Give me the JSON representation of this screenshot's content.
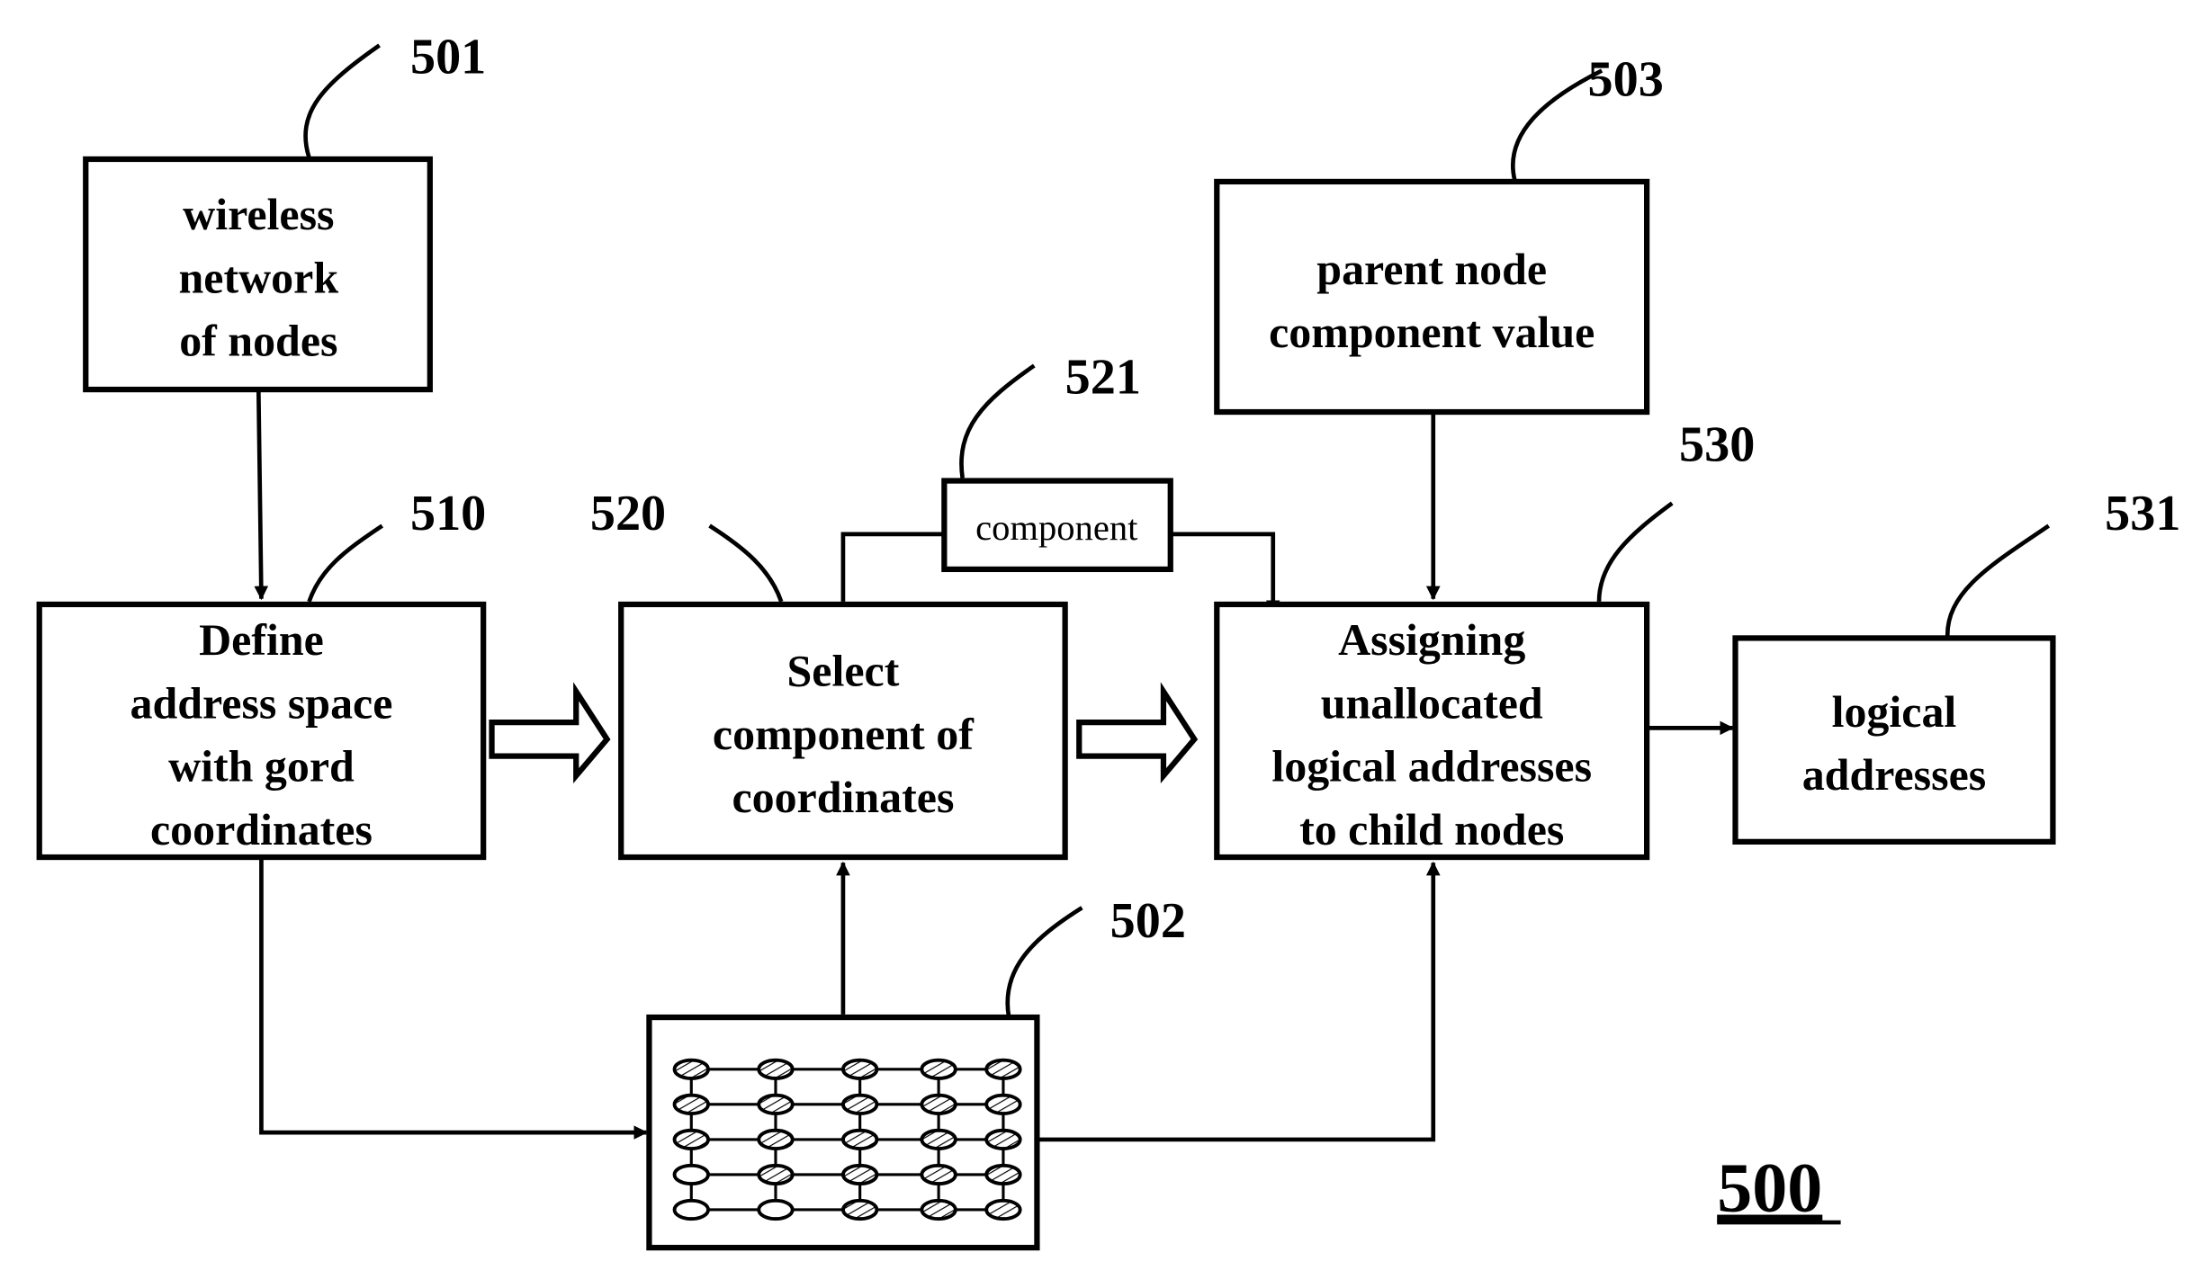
{
  "figure_label": "500",
  "boxes": {
    "b501": {
      "ref": "501",
      "lines": [
        "wireless",
        "network",
        "of nodes"
      ]
    },
    "b510": {
      "ref": "510",
      "lines": [
        "Define",
        "address space",
        "with gord",
        "coordinates"
      ]
    },
    "b520": {
      "ref": "520",
      "lines": [
        "Select",
        "component of",
        "coordinates"
      ]
    },
    "b521": {
      "ref": "521",
      "lines": [
        "component"
      ]
    },
    "b503": {
      "ref": "503",
      "lines": [
        "parent node",
        "component value"
      ]
    },
    "b530": {
      "ref": "530",
      "lines": [
        "Assigning",
        "unallocated",
        "logical addresses",
        "to child nodes"
      ]
    },
    "b531": {
      "ref": "531",
      "lines": [
        "logical",
        "addresses"
      ]
    },
    "b502": {
      "ref": "502"
    }
  },
  "grid": {
    "rows": 5,
    "cols": 5,
    "unfilled": [
      [
        3,
        0
      ],
      [
        4,
        0
      ],
      [
        4,
        1
      ]
    ]
  }
}
